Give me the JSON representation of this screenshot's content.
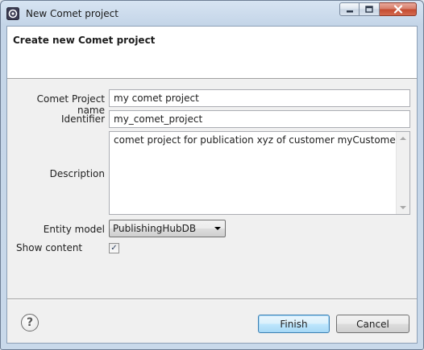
{
  "window": {
    "title": "New Comet project",
    "controls": {
      "minimize": "minimize-icon",
      "maximize": "maximize-icon",
      "close": "close-icon"
    }
  },
  "banner": {
    "title": "Create new Comet project"
  },
  "form": {
    "project_name": {
      "label": "Comet Project name",
      "value": "my comet project"
    },
    "identifier": {
      "label": "Identifier",
      "value": "my_comet_project"
    },
    "description": {
      "label": "Description",
      "value": "comet project for publication xyz of customer myCustomer"
    },
    "entity_model": {
      "label": "Entity model",
      "selected": "PublishingHubDB"
    },
    "show_content": {
      "label": "Show content",
      "checked": true
    }
  },
  "footer": {
    "help_icon": "help-icon",
    "finish_label": "Finish",
    "cancel_label": "Cancel"
  },
  "colors": {
    "default_button_border": "#3c7fb1",
    "close_button": "#c44a2e"
  }
}
